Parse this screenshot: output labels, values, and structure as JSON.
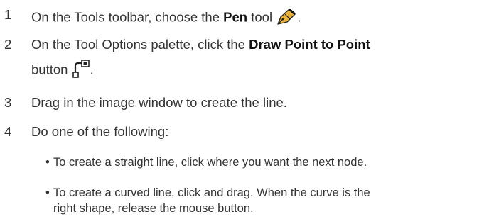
{
  "steps": [
    {
      "num": "1",
      "pre": "On the Tools toolbar, choose the ",
      "bold": "Pen",
      "post": " tool",
      "tail": ".",
      "icon": "pen-tool-icon"
    },
    {
      "num": "2",
      "pre": "On the Tool Options palette, click the ",
      "bold": "Draw Point to Point",
      "line2_pre": "button",
      "line2_post": ".",
      "icon": "draw-point-to-point-icon"
    },
    {
      "num": "3",
      "text": "Drag in the image window to create the line."
    },
    {
      "num": "4",
      "text": "Do one of the following:"
    }
  ],
  "bullets": [
    {
      "glyph": "•",
      "line1": "To create a straight line, click where you want the next node."
    },
    {
      "glyph": "•",
      "line1": "To create a curved line, click and drag. When the curve is the",
      "line2": "right shape, release the mouse button."
    }
  ]
}
